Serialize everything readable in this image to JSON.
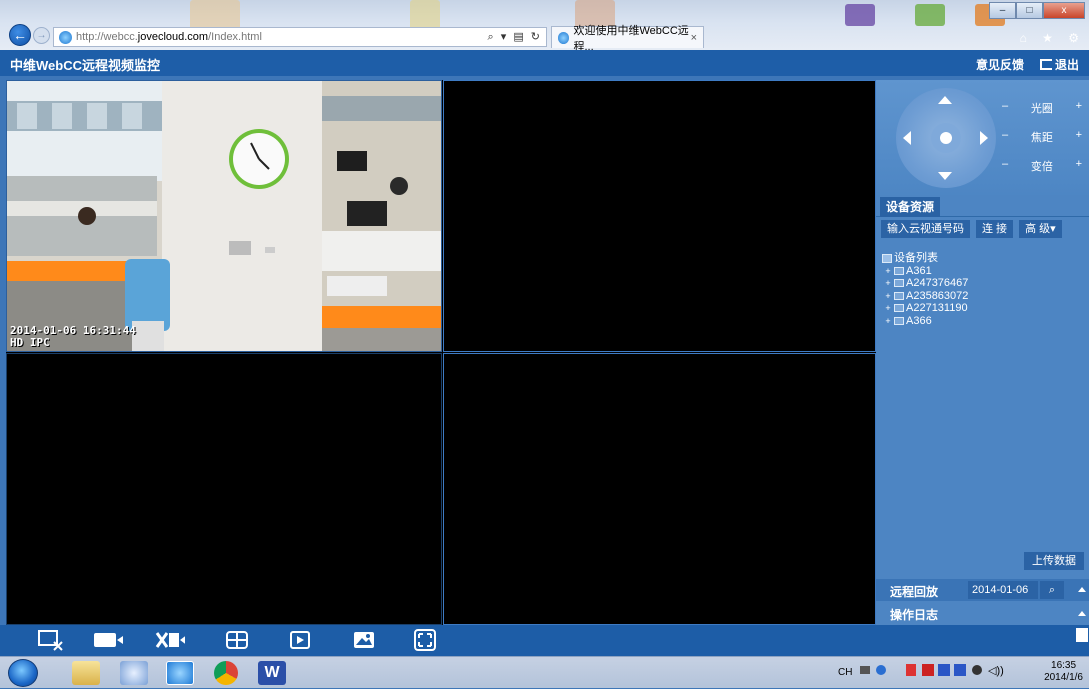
{
  "browser": {
    "url_prefix": "http://webcc.",
    "url_domain": "jovecloud.com",
    "url_path": "/Index.html",
    "tab_title": "欢迎使用中维WebCC远程...",
    "tab_close": "×",
    "minimize": "–",
    "maximize": "□",
    "close": "x",
    "right_icons": "⌂ ★ ⚙"
  },
  "header": {
    "title": "中维WebCC远程视频监控",
    "feedback": "意见反馈",
    "logout": "退出"
  },
  "video": {
    "timestamp": "2014-01-06 16:31:44",
    "channel_label": "HD IPC"
  },
  "ptz": {
    "controls": [
      {
        "minus": "–",
        "label": "光圈",
        "plus": "+"
      },
      {
        "minus": "–",
        "label": "焦距",
        "plus": "+"
      },
      {
        "minus": "–",
        "label": "变倍",
        "plus": "+"
      }
    ]
  },
  "resources": {
    "tab_label": "设备资源",
    "cloud_input": "输入云视通号码",
    "connect": "连 接",
    "advanced": "高 级▾",
    "tree_root": "设备列表",
    "devices": [
      "A361",
      "A247376467",
      "A235863072",
      "A227131190",
      "A366"
    ]
  },
  "bottom_panel": {
    "upload": "上传数据",
    "playback_label": "远程回放",
    "playback_date": "2014-01-06",
    "search_icon": "🔍",
    "oplog_label": "操作日志"
  },
  "toolbar": {
    "icons": [
      "close-view-icon",
      "record-icon",
      "stop-record-icon",
      "layout-icon",
      "play-icon",
      "snapshot-icon",
      "fullscreen-icon"
    ]
  },
  "taskbar": {
    "tray_text": "CH",
    "time": "16:35",
    "date": "2014/1/6"
  }
}
